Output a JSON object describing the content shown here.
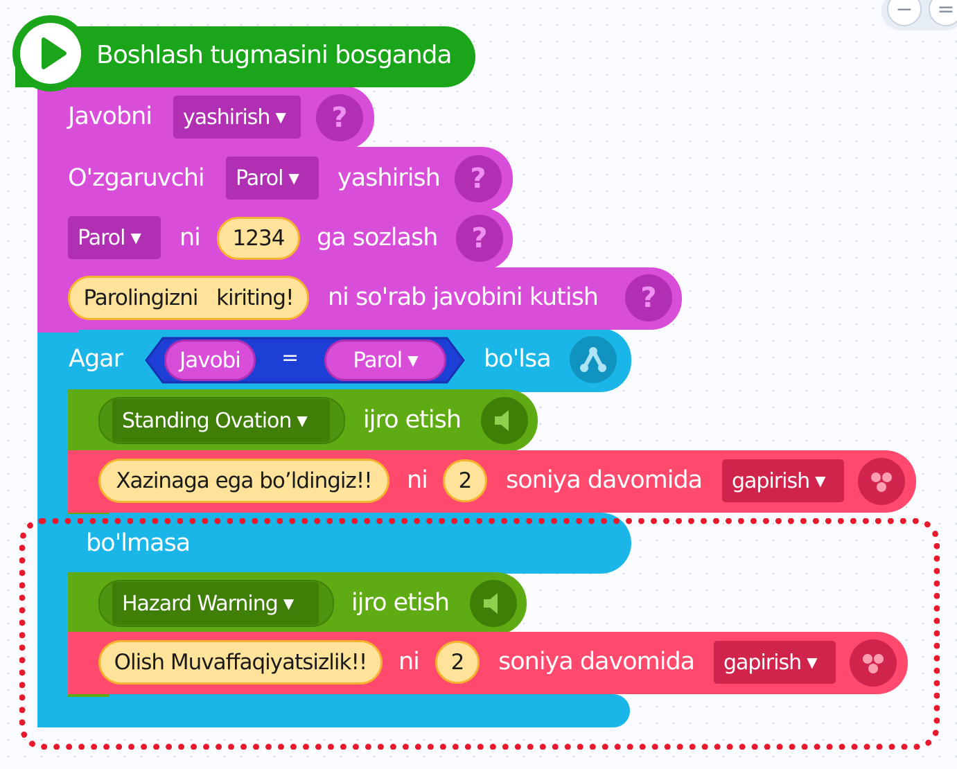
{
  "zoom_controls": {
    "zoom_out": "−",
    "reset": "="
  },
  "hat": {
    "label": "Boshlash tugmasini bosganda"
  },
  "help_symbol": "?",
  "blocks": {
    "hide_answer": {
      "label": "Javobni",
      "dropdown": "yashirish"
    },
    "hide_variable": {
      "label": "O'zgaruvchi",
      "dropdown": "Parol",
      "suffix": "yashirish"
    },
    "set_variable": {
      "dropdown": "Parol",
      "mid": "ni",
      "value": "1234",
      "suffix": "ga sozlash"
    },
    "ask_wait": {
      "text": "Parolingizni   kiriting!",
      "suffix": "ni so'rab javobini kutish"
    },
    "if_else": {
      "if_label": "Agar",
      "condition": {
        "left": "Javobi",
        "operator": "=",
        "right": "Parol"
      },
      "then_label": "bo'lsa",
      "else_label": "bo'lmasa"
    },
    "play_sound_1": {
      "sound": "Standing Ovation",
      "suffix": "ijro etish"
    },
    "say_1": {
      "text": "Xazinaga ega bo’ldingiz!!",
      "mid": "ni",
      "seconds": "2",
      "duration": "soniya davomida",
      "mode": "gapirish"
    },
    "play_sound_2": {
      "sound": "Hazard Warning",
      "suffix": "ijro etish"
    },
    "say_2": {
      "text": "Olish Muvaffaqiyatsizlik!!",
      "mid": "ni",
      "seconds": "2",
      "duration": "soniya davomida",
      "mode": "gapirish"
    }
  },
  "colors": {
    "event": "#1aa51a",
    "sensing": "#d84ed8",
    "sensing_dark": "#b02fb2",
    "control": "#1ab6e8",
    "operator_dark": "#1e3fd6",
    "sound": "#5fab13",
    "sound_dark": "#3f7f08",
    "looks": "#ff4a6e",
    "looks_dark": "#d0244c",
    "highlight": "#e8192c"
  }
}
